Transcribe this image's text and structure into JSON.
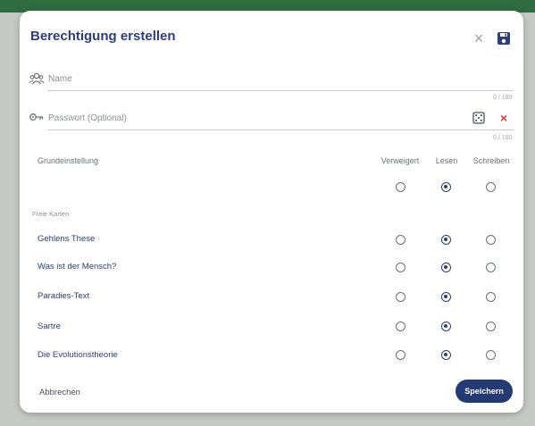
{
  "dialog": {
    "title": "Berechtigung erstellen",
    "close_symbol": "×",
    "save_icon": "floppy-disk-icon"
  },
  "name_field": {
    "placeholder": "Name",
    "value": "",
    "counter": "0 / 180",
    "icon": "users-icon"
  },
  "password_field": {
    "placeholder": "Passwort (Optional)",
    "value": "",
    "counter": "0 / 180",
    "icon": "key-icon",
    "generate_icon": "dice-icon",
    "clear_symbol": "×"
  },
  "permissions": {
    "base_label": "Grundeinstellung",
    "columns": [
      "Verweigert",
      "Lesen",
      "Schreiben"
    ],
    "base_selected": 1,
    "section_label": "Freie Karten",
    "cards": [
      {
        "label": "Gehlens These",
        "selected": 1
      },
      {
        "label": "Was ist der Mensch?",
        "selected": 1
      },
      {
        "label": "Paradies-Text",
        "selected": 1
      },
      {
        "label": "Sartre",
        "selected": 1
      },
      {
        "label": "Die Evolutionstheorie",
        "selected": 1
      }
    ]
  },
  "footer": {
    "cancel_label": "Abbrechen",
    "save_label": "Speichern"
  },
  "colors": {
    "accent": "#2c3e7a",
    "primary_button": "#243a74",
    "danger": "#e53935",
    "background_strip": "#2f6b3f"
  }
}
